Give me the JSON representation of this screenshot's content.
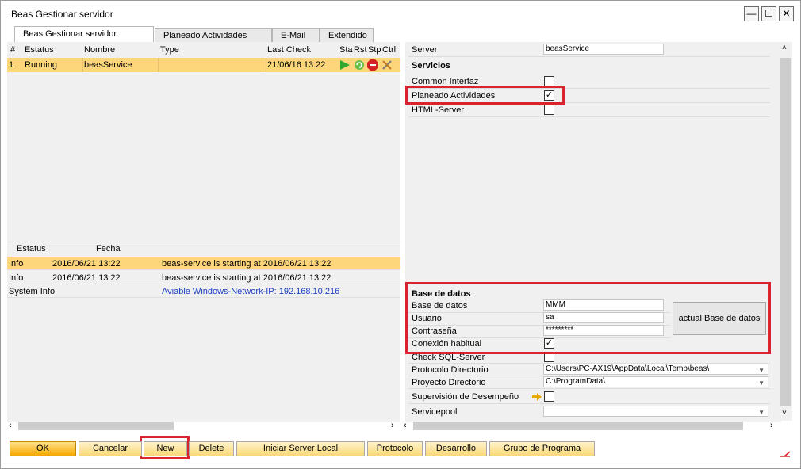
{
  "window": {
    "title": "Beas Gestionar servidor",
    "minimize": "—",
    "maximize": "☐",
    "close": "✕"
  },
  "tabs": [
    {
      "label": "Beas Gestionar servidor"
    },
    {
      "label": "Planeado Actividades"
    },
    {
      "label": "E-Mail"
    },
    {
      "label": "Extendido"
    }
  ],
  "service_grid": {
    "headers": {
      "num": "#",
      "estatus": "Estatus",
      "nombre": "Nombre",
      "type": "Type",
      "last_check": "Last Check",
      "sta": "Sta",
      "rst": "Rst",
      "stp": "Stp",
      "ctrl": "Ctrl"
    },
    "rows": [
      {
        "num": "1",
        "estatus": "Running",
        "nombre": "beasService",
        "type": "",
        "last_check": "21/06/16 13:22"
      }
    ]
  },
  "log_grid": {
    "headers": {
      "estatus": "Estatus",
      "fecha": "Fecha"
    },
    "rows": [
      {
        "estatus": "Info",
        "fecha": "2016/06/21 13:22",
        "message": "beas-service is starting at 2016/06/21 13:22"
      },
      {
        "estatus": "Info",
        "fecha": "2016/06/21 13:22",
        "message": "beas-service is starting at 2016/06/21 13:22"
      },
      {
        "estatus": "System Info",
        "fecha": "",
        "message": "Aviable Windows-Network-IP: 192.168.10.216"
      }
    ]
  },
  "right": {
    "server_label": "Server",
    "server_value": "beasService",
    "servicios_title": "Servicios",
    "common_interfaz": "Common Interfaz",
    "planeado_actividades": "Planeado Actividades",
    "html_server": "HTML-Server",
    "db_title": "Base de datos",
    "db_label": "Base de datos",
    "db_value": "MMM",
    "usuario_label": "Usuario",
    "usuario_value": "sa",
    "contrasena_label": "Contraseña",
    "contrasena_value": "*********",
    "conexion_label": "Conexión habitual",
    "actual_db_button": "actual Base de datos",
    "check_sql": "Check SQL-Server",
    "protocolo_dir_label": "Protocolo Directorio",
    "protocolo_dir_value": "C:\\Users\\PC-AX19\\AppData\\Local\\Temp\\beas\\",
    "proyecto_dir_label": "Proyecto Directorio",
    "proyecto_dir_value": "C:\\ProgramData\\",
    "supervision_label": "Supervisión de Desempeño",
    "servicepool_label": "Servicepool",
    "servicepool_value": ""
  },
  "buttons": {
    "ok": "OK",
    "cancelar": "Cancelar",
    "new": "New",
    "delete": "Delete",
    "iniciar": "Iniciar Server Local",
    "protocolo": "Protocolo",
    "desarrollo": "Desarrollo",
    "grupo": "Grupo de Programa"
  },
  "colors": {
    "highlight": "#fdd57b",
    "annotation_red": "#d9232e",
    "link_blue": "#1a3fbf"
  }
}
